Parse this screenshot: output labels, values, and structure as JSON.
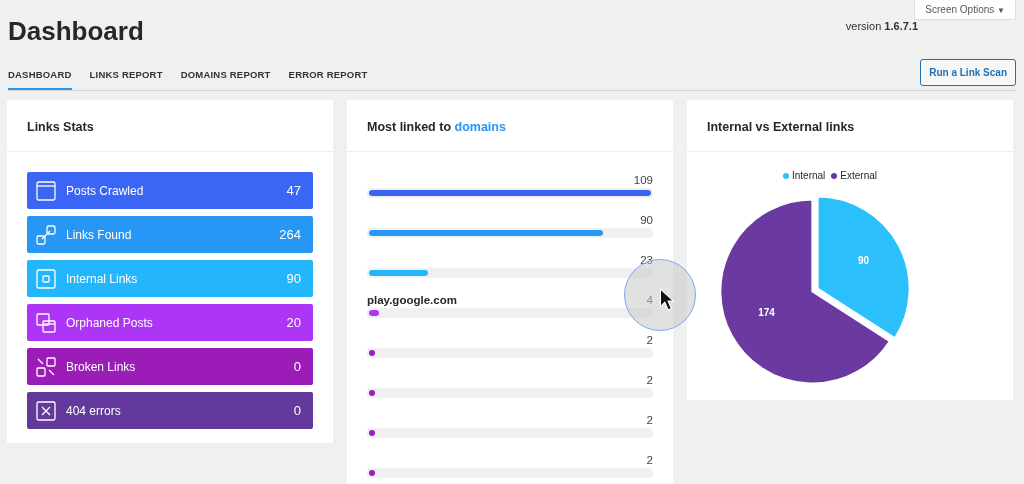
{
  "header": {
    "title": "Dashboard",
    "screen_options": "Screen Options",
    "caret": "▼",
    "version_label": "version",
    "version": "1.6.7.1"
  },
  "tabs": [
    {
      "label": "DASHBOARD",
      "selected": true
    },
    {
      "label": "LINKS REPORT",
      "selected": false
    },
    {
      "label": "DOMAINS REPORT",
      "selected": false
    },
    {
      "label": "ERROR REPORT",
      "selected": false
    }
  ],
  "scan_button": "Run a Link Scan",
  "links_stats": {
    "title": "Links Stats",
    "items": [
      {
        "label": "Posts Crawled",
        "value": "47",
        "color": "#3b66f5"
      },
      {
        "label": "Links Found",
        "value": "264",
        "color": "#2797f5"
      },
      {
        "label": "Internal Links",
        "value": "90",
        "color": "#23b6fb"
      },
      {
        "label": "Orphaned Posts",
        "value": "20",
        "color": "#ad35f5"
      },
      {
        "label": "Broken Links",
        "value": "0",
        "color": "#9c1cb8"
      },
      {
        "label": "404 errors",
        "value": "0",
        "color": "#633a9b"
      }
    ]
  },
  "domains": {
    "title": "Most linked to **domains**",
    "rows": [
      {
        "count": "109",
        "level": 1,
        "color": "#3b66f5"
      },
      {
        "count": "90",
        "level": 0.83,
        "color": "#2797f5"
      },
      {
        "count": "23",
        "level": 0.21,
        "color": "#23b6fb"
      },
      {
        "name": "play.google.com",
        "count": "4",
        "level": 0.037,
        "color": "#ad35f5"
      },
      {
        "count": "2",
        "level": 0.018,
        "color": "#9c1cb8"
      },
      {
        "count": "2",
        "level": 0.018,
        "color": "#9c1cb8"
      },
      {
        "count": "2",
        "level": 0.018,
        "color": "#9c1cb8"
      },
      {
        "count": "2",
        "level": 0.018,
        "color": "#9c1cb8"
      }
    ]
  },
  "pie_card": {
    "title": "Internal vs External links",
    "chart_data": {
      "type": "pie",
      "categories": [
        "Internal",
        "External"
      ],
      "values": [
        90,
        174
      ],
      "colors": [
        "#2bc0fb",
        "#6b3aa0"
      ],
      "data_labels": true
    }
  }
}
